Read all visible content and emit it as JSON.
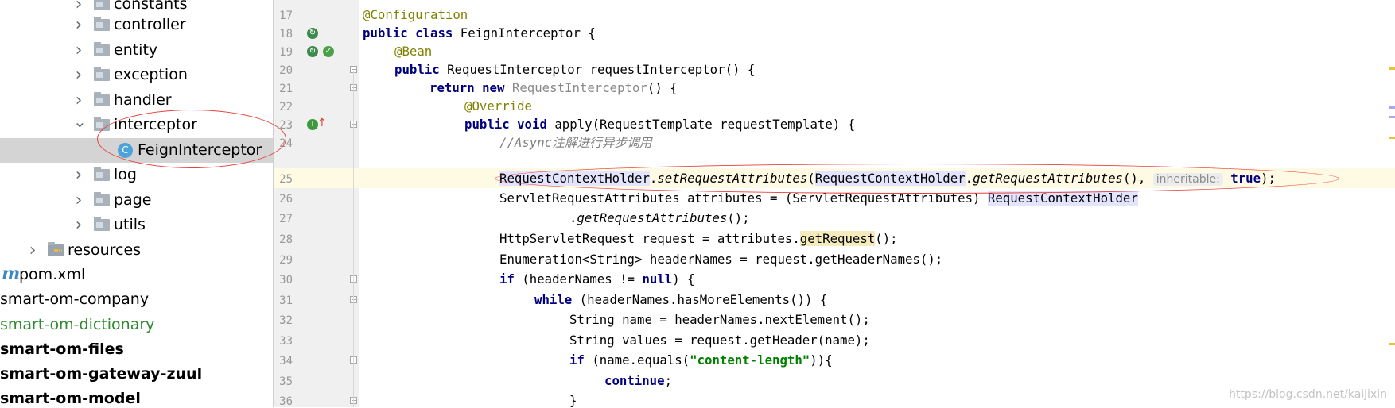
{
  "project_tree": {
    "items": [
      {
        "label": "constants",
        "kind": "folder",
        "expanded": false
      },
      {
        "label": "controller",
        "kind": "folder",
        "expanded": false
      },
      {
        "label": "entity",
        "kind": "folder",
        "expanded": false
      },
      {
        "label": "exception",
        "kind": "folder",
        "expanded": false
      },
      {
        "label": "handler",
        "kind": "folder",
        "expanded": false
      },
      {
        "label": "interceptor",
        "kind": "folder",
        "expanded": true
      },
      {
        "label": "FeignInterceptor",
        "kind": "class",
        "selected": true,
        "badge": "C"
      },
      {
        "label": "log",
        "kind": "folder",
        "expanded": false
      },
      {
        "label": "page",
        "kind": "folder",
        "expanded": false
      },
      {
        "label": "utils",
        "kind": "folder",
        "expanded": false
      },
      {
        "label": "resources",
        "kind": "resources-folder",
        "expanded": false
      },
      {
        "label": "pom.xml",
        "kind": "maven-file",
        "badge": "m"
      },
      {
        "label": "smart-om-company",
        "kind": "module"
      },
      {
        "label": "smart-om-dictionary",
        "kind": "module",
        "color": "#2d8a2d"
      },
      {
        "label": "smart-om-files",
        "kind": "module",
        "bold": true
      },
      {
        "label": "smart-om-gateway-zuul",
        "kind": "module",
        "bold": true
      },
      {
        "label": "smart-om-model",
        "kind": "module",
        "bold": true
      }
    ]
  },
  "editor": {
    "current_line": 25,
    "line_numbers": [
      "17",
      "18",
      "19",
      "20",
      "21",
      "22",
      "23",
      "24",
      "25",
      "26",
      "27",
      "28",
      "29",
      "30",
      "31",
      "32",
      "33",
      "34",
      "35",
      "36"
    ],
    "code": {
      "l17": {
        "ann": "@Configuration"
      },
      "l18": {
        "kw1": "public class",
        "rest": " FeignInterceptor {"
      },
      "l19": {
        "ann": "@Bean"
      },
      "l20": {
        "kw1": "public",
        "rest": " RequestInterceptor requestInterceptor() {"
      },
      "l21": {
        "kw1": "return new",
        "gray": " RequestInterceptor",
        "rest": "() {"
      },
      "l22": {
        "ann": "@Override"
      },
      "l23": {
        "kw1": "public void",
        "rest": " apply(RequestTemplate requestTemplate) {"
      },
      "l24": {
        "cmt": "//Async注解进行异步调用"
      },
      "l25": {
        "cls1": "RequestContextHolder",
        "dot1": ".",
        "method1": "setRequestAttributes",
        "paren1": "(",
        "cls2": "RequestContextHolder",
        "dot2": ".",
        "method2": "getRequestAttributes",
        "rest": "(), ",
        "hint": "inheritable:",
        "kw": "true",
        "tail": ");"
      },
      "l26": {
        "rest": "ServletRequestAttributes attributes = (ServletRequestAttributes) ",
        "cls": "RequestContextHolder"
      },
      "l27": {
        "dot": ".",
        "method": "getRequestAttributes",
        "rest": "();"
      },
      "l28": {
        "rest": "HttpServletRequest request = attributes.",
        "hl": "getRequest",
        "tail": "();"
      },
      "l29": {
        "rest": "Enumeration<String> headerNames = request.getHeaderNames();"
      },
      "l30": {
        "kw1": "if",
        "rest": " (headerNames != ",
        "kw2": "null",
        "tail": ") {"
      },
      "l31": {
        "kw1": "while",
        "rest": " (headerNames.hasMoreElements()) {"
      },
      "l32": {
        "rest": "String name = headerNames.nextElement();"
      },
      "l33": {
        "rest": "String values = request.getHeader(name);"
      },
      "l34": {
        "kw1": "if",
        "rest": " (name.equals(",
        "str": "\"content-length\"",
        "tail": ")){"
      },
      "l35": {
        "kw1": "continue",
        "rest": ";"
      },
      "l36": {
        "rest": "}"
      }
    }
  },
  "gutter_icons": [
    {
      "line": 18,
      "name": "spring-bean-icon",
      "glyph": "↻",
      "color": "#3c8a4e"
    },
    {
      "line": 19,
      "name": "spring-bean-icon",
      "glyph": "↻",
      "color": "#3c8a4e"
    },
    {
      "line": 19,
      "name": "navigate-bean-icon",
      "glyph": "✓",
      "color": "#4aa14a"
    },
    {
      "line": 23,
      "name": "implements-method-icon",
      "glyph": "I",
      "color": "#3c9a3c"
    }
  ],
  "watermark": "https://blog.csdn.net/kaijixin",
  "colors": {
    "keyword": "#000080",
    "annotation": "#808000",
    "comment": "#808080",
    "string": "#008000",
    "highlight_circle": "#e8413c",
    "current_line": "#fffae3",
    "selected_row": "#d4d4d4"
  }
}
